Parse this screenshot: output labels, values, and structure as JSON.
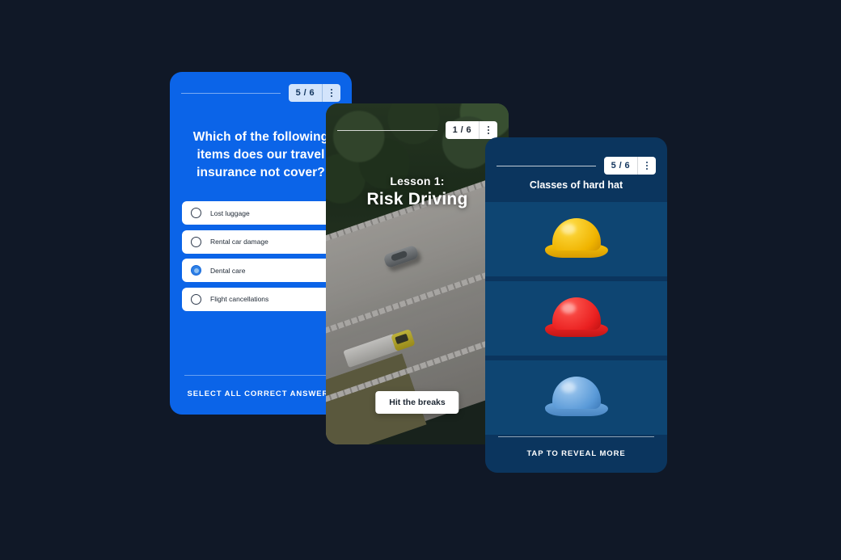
{
  "background_color": "#101827",
  "quiz_card": {
    "accent_color": "#0B64E8",
    "progress": "5 / 6",
    "menu_icon": "kebab-menu-icon",
    "question": "Which of the following items does our travel insurance not cover?",
    "options": [
      {
        "label": "Lost luggage",
        "selected": false
      },
      {
        "label": "Rental car damage",
        "selected": false
      },
      {
        "label": "Dental care",
        "selected": true
      },
      {
        "label": "Flight cancellations",
        "selected": false
      }
    ],
    "footer_cta": "SELECT ALL CORRECT ANSWERS"
  },
  "lesson_card": {
    "progress": "1 / 6",
    "menu_icon": "kebab-menu-icon",
    "eyebrow": "Lesson 1:",
    "title": "Risk Driving",
    "pill_label": "Hit the breaks",
    "photo_description": "aerial-highway-photo"
  },
  "hats_card": {
    "accent_color": "#0B355E",
    "panel_color": "#0E4572",
    "progress": "5 / 6",
    "menu_icon": "kebab-menu-icon",
    "title": "Classes of hard hat",
    "items": [
      {
        "name": "yellow-hard-hat",
        "color": "#F0B400"
      },
      {
        "name": "red-hard-hat",
        "color": "#EA2020"
      },
      {
        "name": "blue-hard-hat",
        "color": "#5A9AD8"
      }
    ],
    "footer_cta": "TAP TO REVEAL MORE"
  }
}
